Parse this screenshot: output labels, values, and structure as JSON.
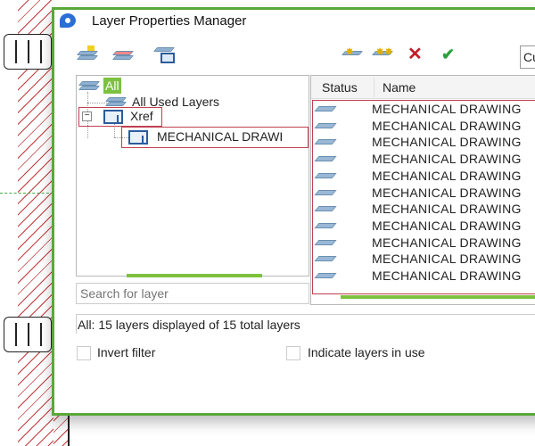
{
  "window": {
    "title": "Layer Properties Manager"
  },
  "toolbar_left": [
    {
      "icon": "new-property-filter-icon"
    },
    {
      "icon": "new-group-filter-icon"
    },
    {
      "icon": "layer-states-manager-icon"
    }
  ],
  "toolbar_right": [
    {
      "icon": "new-layer-icon"
    },
    {
      "icon": "new-layer-vp-frozen-icon"
    },
    {
      "icon": "delete-layer-icon"
    },
    {
      "icon": "set-current-icon"
    }
  ],
  "current_field": {
    "value": "Cu"
  },
  "tree": {
    "all": "All",
    "all_used": "All Used Layers",
    "xref": "Xref",
    "xref_child": "MECHANICAL DRAWI"
  },
  "search": {
    "placeholder": "Search for layer"
  },
  "list": {
    "columns": [
      "Status",
      "Name"
    ],
    "rows": [
      "MECHANICAL DRAWING",
      "MECHANICAL DRAWING",
      "MECHANICAL DRAWING",
      "MECHANICAL DRAWING",
      "MECHANICAL DRAWING",
      "MECHANICAL DRAWING",
      "MECHANICAL DRAWING",
      "MECHANICAL DRAWING",
      "MECHANICAL DRAWING",
      "MECHANICAL DRAWING",
      "MECHANICAL DRAWING"
    ]
  },
  "status_text": "All:  15 layers displayed of  15 total layers",
  "options": {
    "invert_filter": "Invert filter",
    "indicate_in_use": "Indicate layers in use"
  },
  "colors": {
    "window_border": "#5aa83a",
    "highlight": "#c04050",
    "accent_green": "#7cc140"
  }
}
